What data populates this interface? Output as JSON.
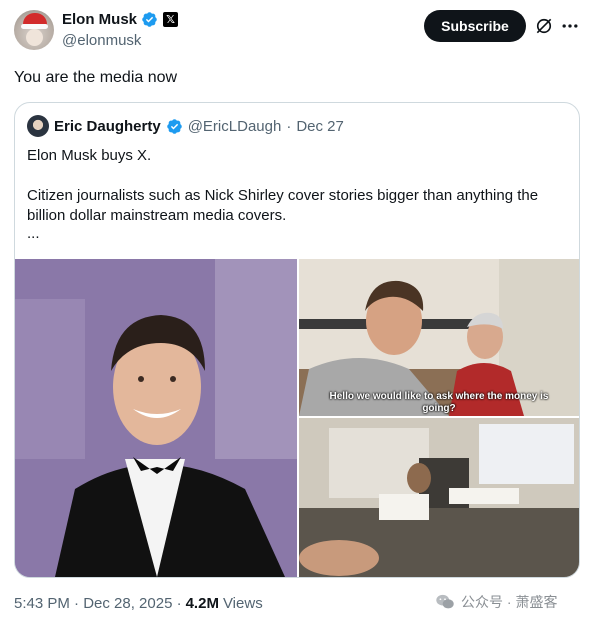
{
  "post": {
    "author_name": "Elon Musk",
    "author_handle": "@elonmusk",
    "subscribe_label": "Subscribe",
    "text": "You are the media now",
    "timestamp": "5:43 PM · Dec 28, 2025 ·",
    "views_count": "4.2M",
    "views_label": "Views"
  },
  "quote": {
    "author_name": "Eric Daugherty",
    "author_handle": "@EricLDaugh",
    "separator": "·",
    "date": "Dec 27",
    "line1": "Elon Musk buys X.",
    "line2": "Citizen journalists such as Nick Shirley cover stories bigger than anything the billion dollar mainstream media covers.",
    "ellipsis": "...",
    "video_caption": "Hello we would like to ask where the money is going?"
  },
  "watermark": {
    "text": "公众号 · 萧盛客"
  },
  "colors": {
    "text_primary": "#0f1419",
    "text_secondary": "#536471",
    "verified_blue": "#1d9bf0",
    "border": "#cfd9de"
  }
}
